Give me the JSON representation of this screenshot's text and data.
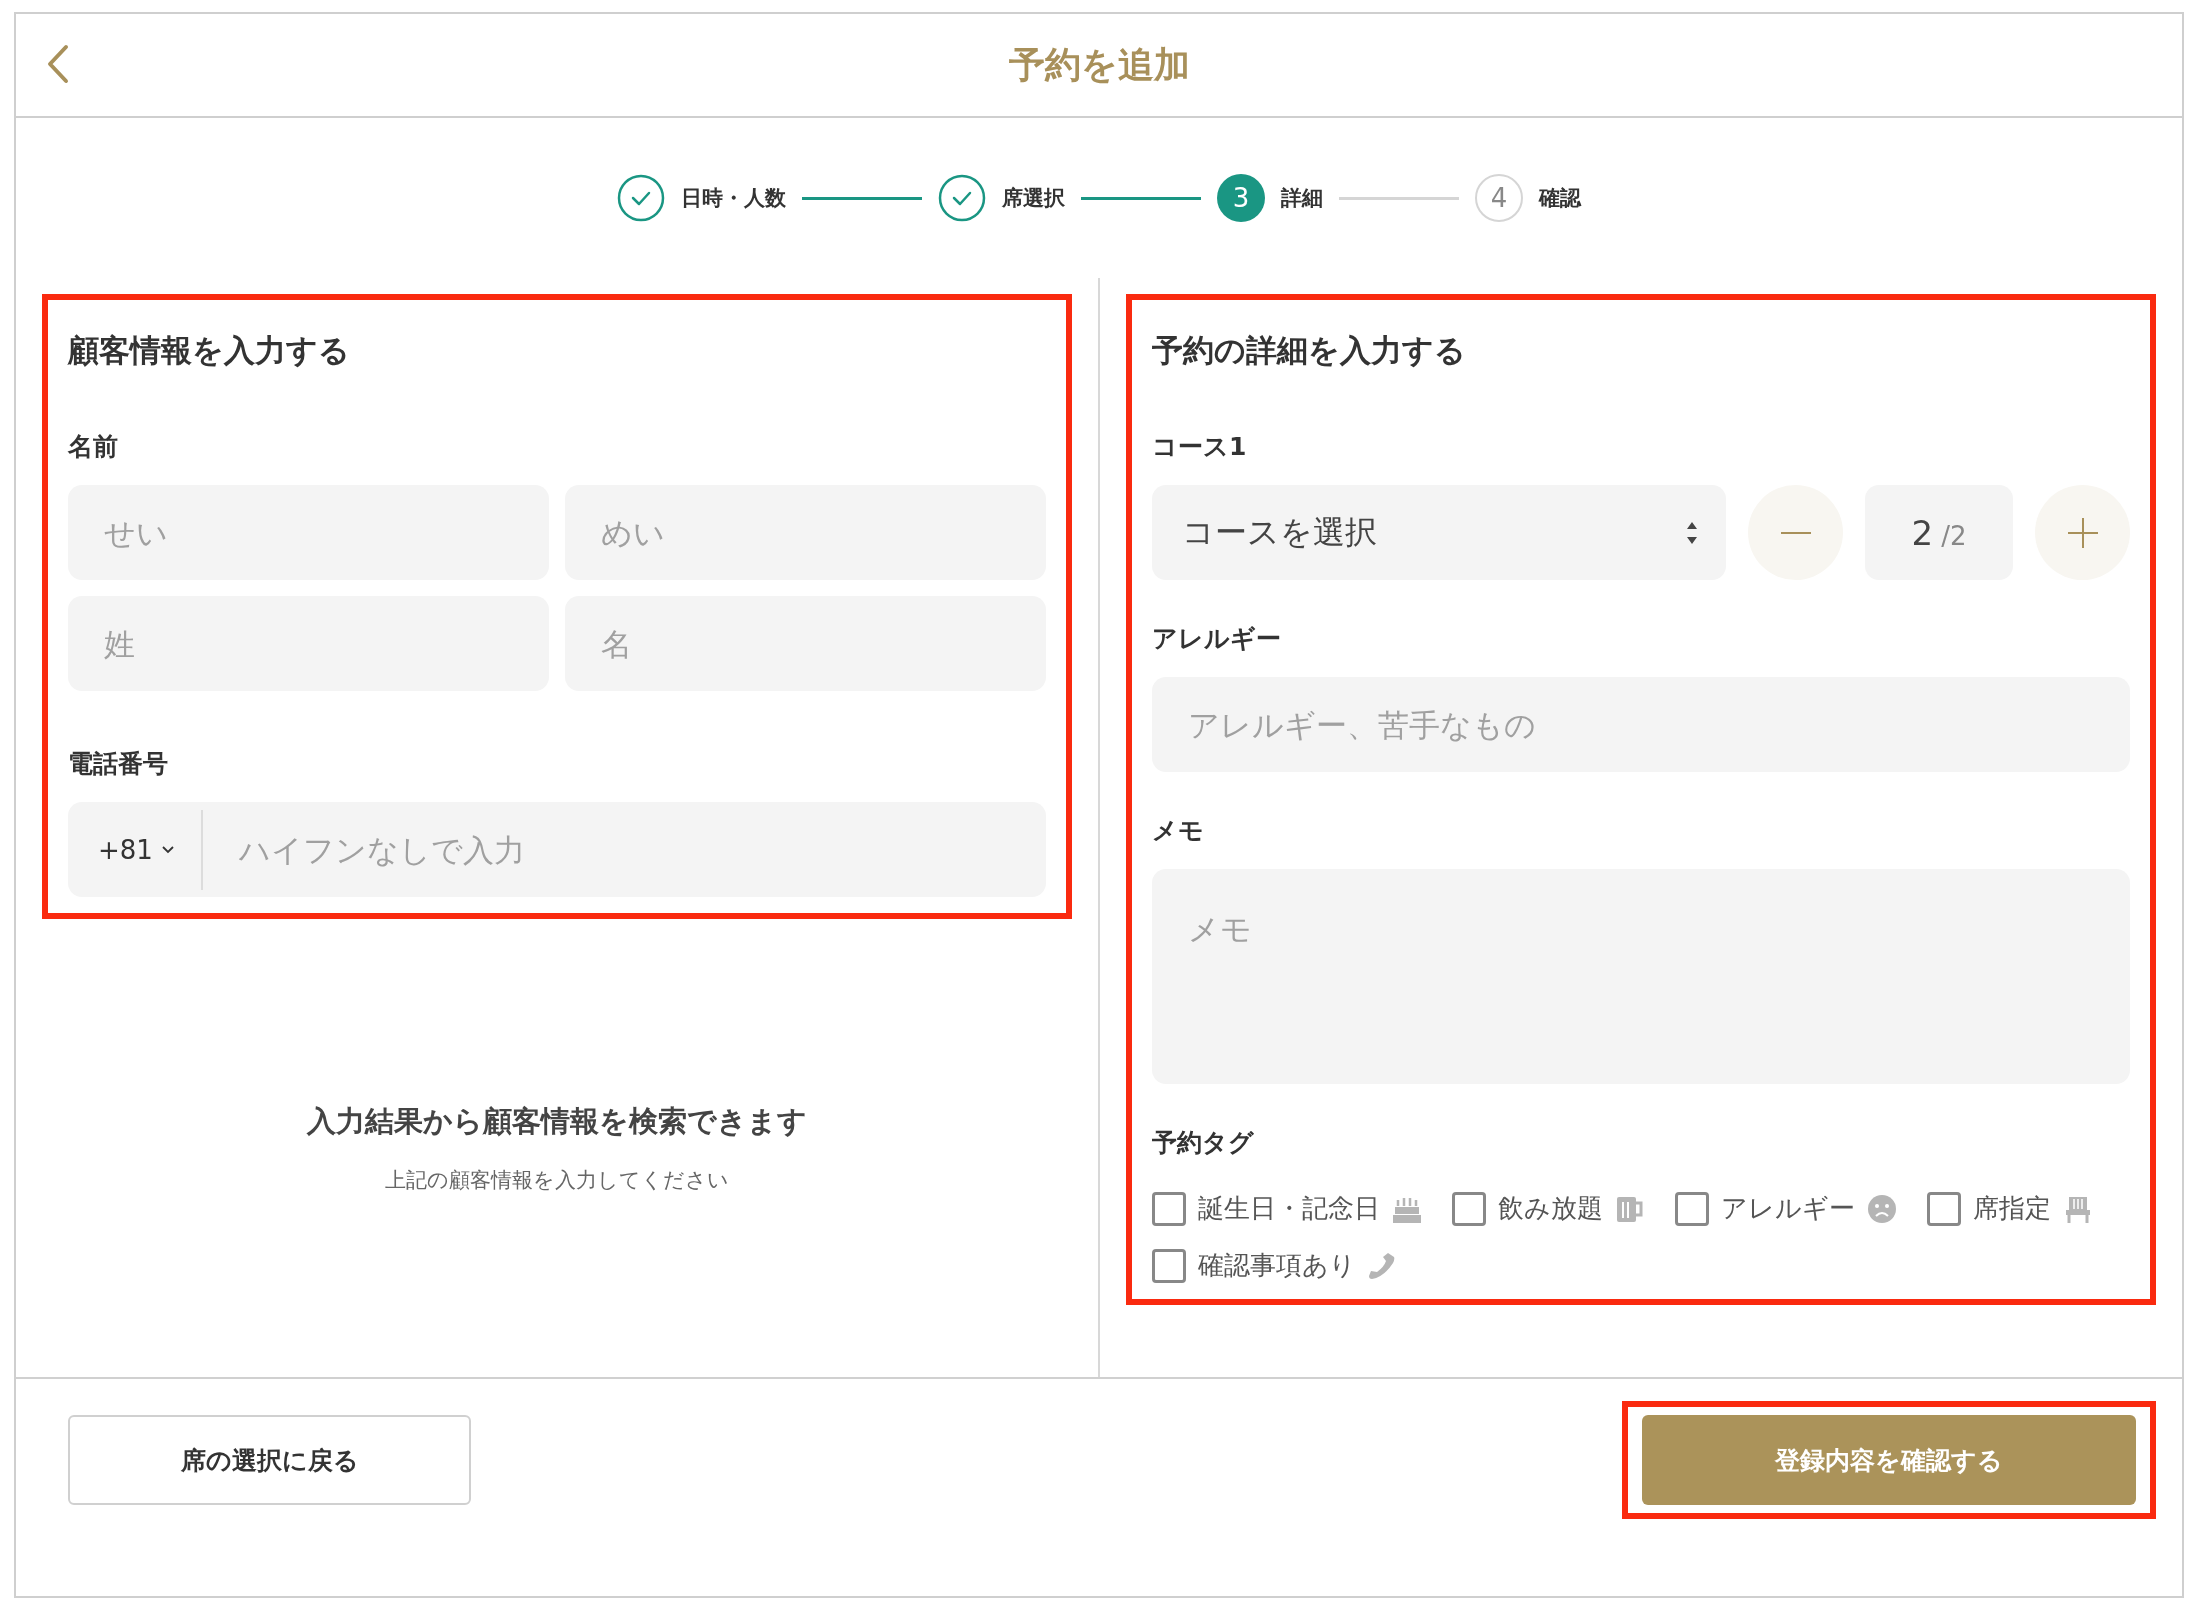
{
  "header": {
    "title": "予約を追加"
  },
  "steps": [
    {
      "label": "日時・人数",
      "done": true,
      "selected": false
    },
    {
      "label": "席選択",
      "done": true,
      "selected": false
    },
    {
      "label": "詳細",
      "number": "3",
      "done": false,
      "selected": true
    },
    {
      "label": "確認",
      "number": "4",
      "done": false,
      "selected": false
    }
  ],
  "customer": {
    "highlighted": true,
    "heading": "顧客情報を入力する",
    "name_label": "名前",
    "name_fields": [
      {
        "placeholder": "せい"
      },
      {
        "placeholder": "めい"
      },
      {
        "placeholder": "姓"
      },
      {
        "placeholder": "名"
      }
    ],
    "phone_label": "電話番号",
    "country_code": "+81",
    "phone_placeholder": "ハイフンなしで入力"
  },
  "search_hint": {
    "title": "入力結果から顧客情報を検索できます",
    "subtitle": "上記の顧客情報を入力してください"
  },
  "details": {
    "highlighted": true,
    "heading": "予約の詳細を入力する",
    "course_label": "コース1",
    "course_placeholder": "コースを選択",
    "quantity": "2",
    "quantity_max": "/2",
    "allergy_label": "アレルギー",
    "allergy_placeholder": "アレルギー、苦手なもの",
    "memo_label": "メモ",
    "memo_placeholder": "メモ",
    "tags_label": "予約タグ",
    "tags": [
      {
        "label": "誕生日・記念日",
        "checked": false
      },
      {
        "label": "飲み放題",
        "checked": false
      },
      {
        "label": "アレルギー",
        "checked": false
      },
      {
        "label": "席指定",
        "checked": false
      },
      {
        "label": "確認事項あり",
        "checked": false
      }
    ]
  },
  "footer": {
    "back_button": "席の選択に戻る",
    "confirm_button": "登録内容を確認する",
    "confirm_highlighted": true
  }
}
